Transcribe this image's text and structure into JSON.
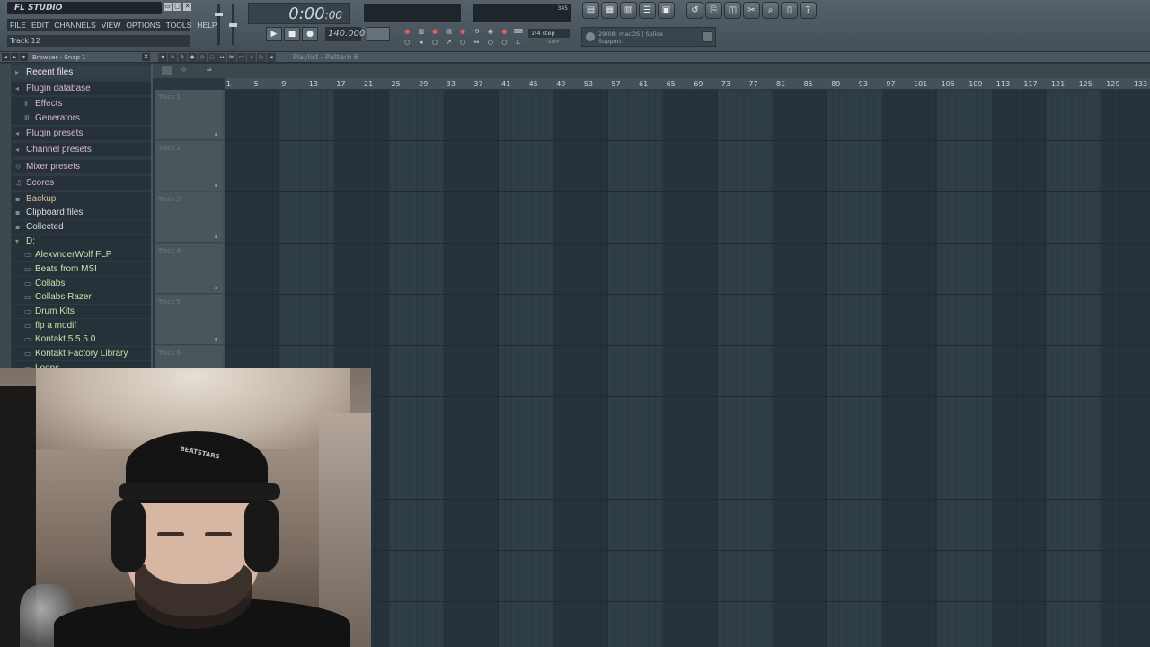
{
  "app": {
    "logo": "FL STUDIO",
    "menu": [
      "FILE",
      "EDIT",
      "CHANNELS",
      "VIEW",
      "OPTIONS",
      "TOOLS",
      "HELP"
    ],
    "hint": "Track 12",
    "window_controls": [
      "▭",
      "▢",
      "✕"
    ]
  },
  "transport": {
    "time_main": "0:00",
    "time_frac": ":00",
    "play": "▶",
    "stop": "■",
    "record": "●",
    "tempo": "140.000",
    "snap": "1/4 step",
    "snap_sub": "STEP",
    "cpu_value": "345"
  },
  "news": {
    "line1": "29/08: macOS | Splice",
    "line2": "Support"
  },
  "browser": {
    "title": "Browser - Snap 1",
    "close": "✕",
    "items": [
      {
        "label": "Recent files",
        "icon": "▸",
        "color": "pink"
      },
      {
        "label": "Plugin database",
        "icon": "◂",
        "color": "pink"
      },
      {
        "label": "Effects",
        "icon": "Ⅱ",
        "color": "pink"
      },
      {
        "label": "Generators",
        "icon": "Ⅲ",
        "color": "pink"
      },
      {
        "label": "Plugin presets",
        "icon": "◂",
        "color": "pink"
      },
      {
        "label": "Channel presets",
        "icon": "◂",
        "color": "pink"
      },
      {
        "label": "Mixer presets",
        "icon": "⟐",
        "color": "pink"
      },
      {
        "label": "Scores",
        "icon": "♫",
        "color": "pink"
      },
      {
        "label": "Backup",
        "icon": "▪",
        "color": "gold"
      },
      {
        "label": "Clipboard files",
        "icon": "▪",
        "color": "white"
      },
      {
        "label": "Collected",
        "icon": "▪",
        "color": "white"
      },
      {
        "label": "D:",
        "icon": "▾",
        "color": "green"
      },
      {
        "label": "AlexvnderWolf FLP",
        "icon": "▭",
        "color": "green"
      },
      {
        "label": "Beats from MSI",
        "icon": "▭",
        "color": "green"
      },
      {
        "label": "Collabs",
        "icon": "▭",
        "color": "green"
      },
      {
        "label": "Collabs Razer",
        "icon": "▭",
        "color": "green"
      },
      {
        "label": "Drum Kits",
        "icon": "▭",
        "color": "green"
      },
      {
        "label": "flp a modif",
        "icon": "▭",
        "color": "green"
      },
      {
        "label": "Kontakt 5 5.5.0",
        "icon": "▭",
        "color": "green"
      },
      {
        "label": "Kontakt Factory Library",
        "icon": "▭",
        "color": "green"
      },
      {
        "label": "Loops",
        "icon": "▭",
        "color": "green"
      }
    ]
  },
  "playlist": {
    "title": "Playlist - Pattern 6",
    "ruler": [
      "1",
      "5",
      "9",
      "13",
      "17",
      "21",
      "25",
      "29",
      "33",
      "37",
      "41",
      "45",
      "49",
      "53",
      "57",
      "61",
      "65",
      "69",
      "73",
      "77",
      "81",
      "85",
      "89",
      "93",
      "97",
      "101",
      "105",
      "109",
      "113",
      "117",
      "121",
      "125",
      "129",
      "133"
    ],
    "tracks": [
      "Track 1",
      "Track 2",
      "Track 3",
      "Track 4",
      "Track 5",
      "Track 6"
    ]
  },
  "webcam": {
    "cap_text": "BEATSTARS"
  }
}
